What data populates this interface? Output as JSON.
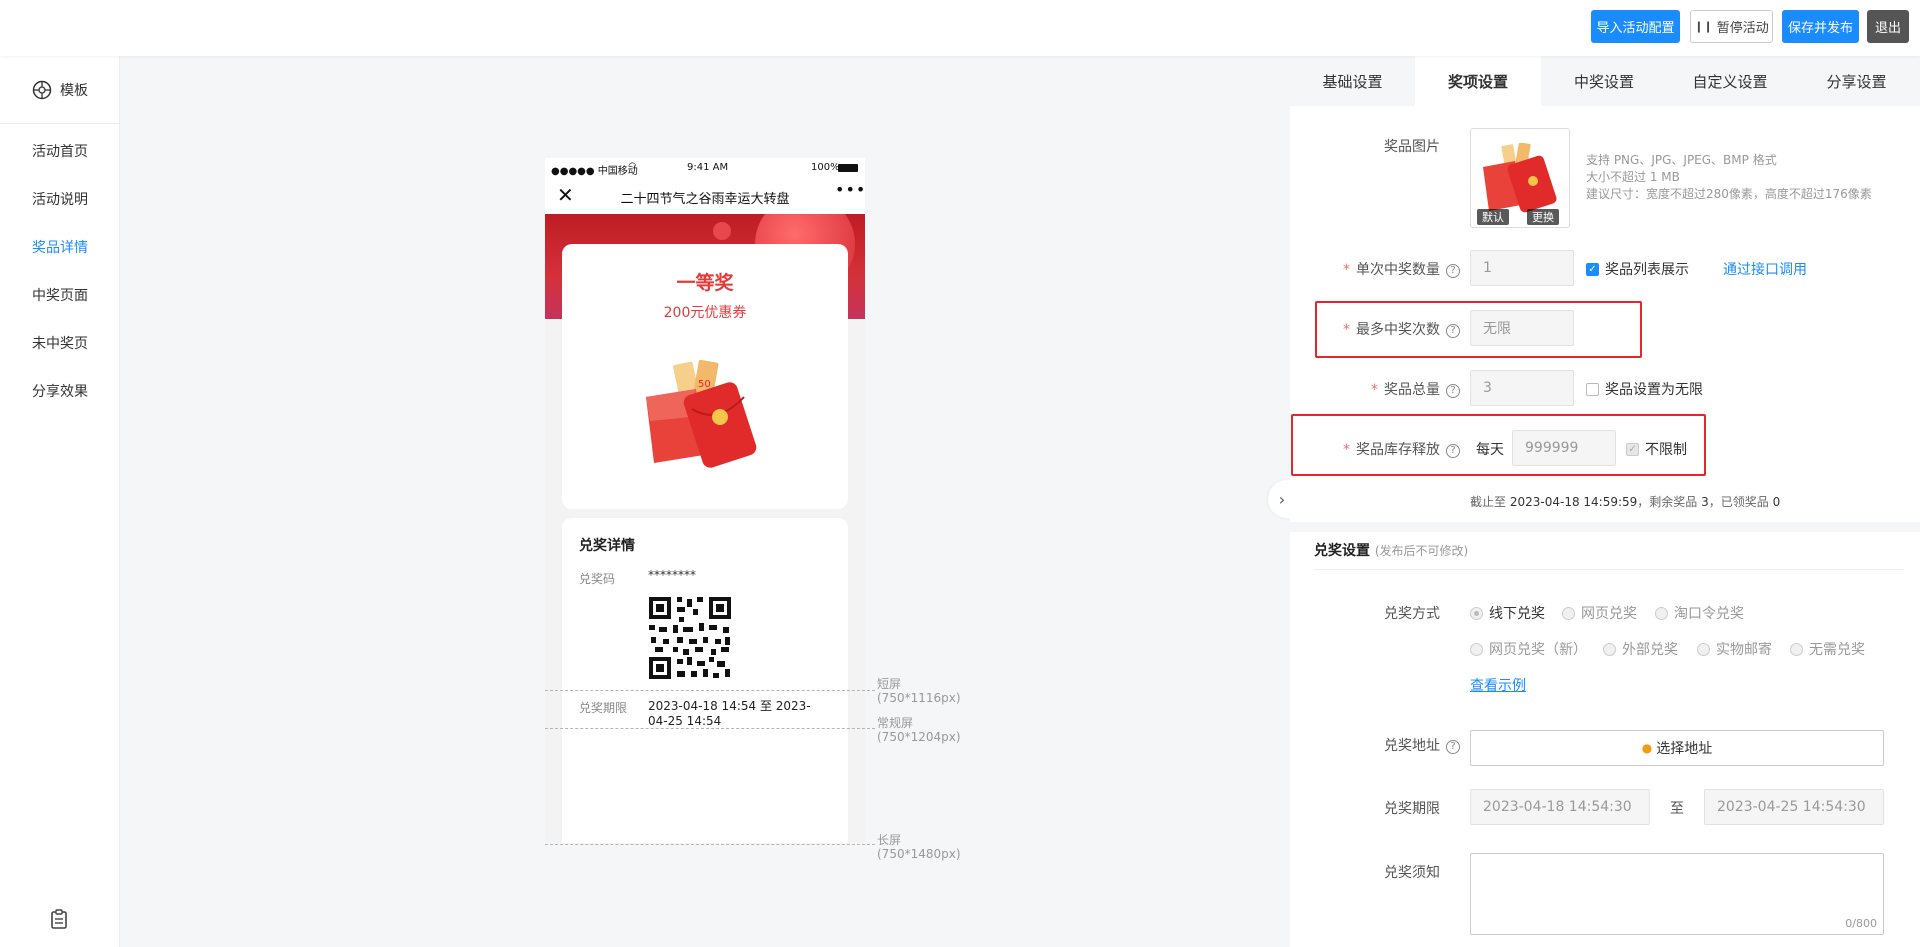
{
  "topbar": {
    "import_label": "导入活动配置",
    "pause_label": "暂停活动",
    "save_label": "保存并发布",
    "exit_label": "退出"
  },
  "sidebar": {
    "template_label": "模板",
    "items": [
      {
        "label": "活动首页"
      },
      {
        "label": "活动说明"
      },
      {
        "label": "奖品详情"
      },
      {
        "label": "中奖页面"
      },
      {
        "label": "未中奖页"
      },
      {
        "label": "分享效果"
      }
    ],
    "active_index": 2
  },
  "phone": {
    "carrier": "●●●●● 中国移动",
    "time": "9:41 AM",
    "battery": "100%",
    "title": "二十四节气之谷雨幸运大转盘",
    "prize_level": "一等奖",
    "prize_name": "200元优惠券",
    "redeem_title": "兑奖详情",
    "code_label": "兑奖码",
    "code_value": "********",
    "period_label": "兑奖期限",
    "period_value": "2023-04-18 14:54 至 2023-04-25 14:54"
  },
  "guides": [
    {
      "name": "短屏",
      "size": "(750*1116px)"
    },
    {
      "name": "常规屏",
      "size": "(750*1204px)"
    },
    {
      "name": "长屏",
      "size": "(750*1480px)"
    }
  ],
  "panel": {
    "tabs": [
      "基础设置",
      "奖项设置",
      "中奖设置",
      "自定义设置",
      "分享设置"
    ],
    "active_tab": 1,
    "prize_image": {
      "label": "奖品图片",
      "default_label": "默认",
      "change_label": "更换",
      "hint1": "支持 PNG、JPG、JPEG、BMP 格式",
      "hint2": "大小不超过 1 MB",
      "hint3": "建议尺寸：宽度不超过280像素，高度不超过176像素"
    },
    "single_count": {
      "label": "单次中奖数量",
      "value": "1",
      "check_label": "奖品列表展示",
      "link": "通过接口调用"
    },
    "max_times": {
      "label": "最多中奖次数",
      "placeholder": "无限"
    },
    "total": {
      "label": "奖品总量",
      "value": "3",
      "check_label": "奖品设置为无限"
    },
    "release": {
      "label": "奖品库存释放",
      "prefix": "每天",
      "value": "999999",
      "check_label": "不限制"
    },
    "status": {
      "prefix": "截止至",
      "date": "2023-04-18 14:59:59",
      "remain_text": "，剩余奖品",
      "remain": "3",
      "received_text": "，已领奖品",
      "received": "0"
    },
    "redeem": {
      "title": "兑奖设置",
      "subtitle": "(发布后不可修改)",
      "method_label": "兑奖方式",
      "methods": [
        "线下兑奖",
        "网页兑奖",
        "淘口令兑奖",
        "网页兑奖（新）",
        "外部兑奖",
        "实物邮寄",
        "无需兑奖"
      ],
      "example_link": "查看示例",
      "address_label": "兑奖地址",
      "address_button": "选择地址",
      "period_label": "兑奖期限",
      "start": "2023-04-18 14:54:30",
      "to": "至",
      "end": "2023-04-25 14:54:30",
      "notice_label": "兑奖须知",
      "counter": "0/800"
    }
  },
  "colors": {
    "primary": "#1a8cff",
    "required": "#f56c6c",
    "highlight": "#e5262d",
    "prize_red": "#e33b3b"
  }
}
